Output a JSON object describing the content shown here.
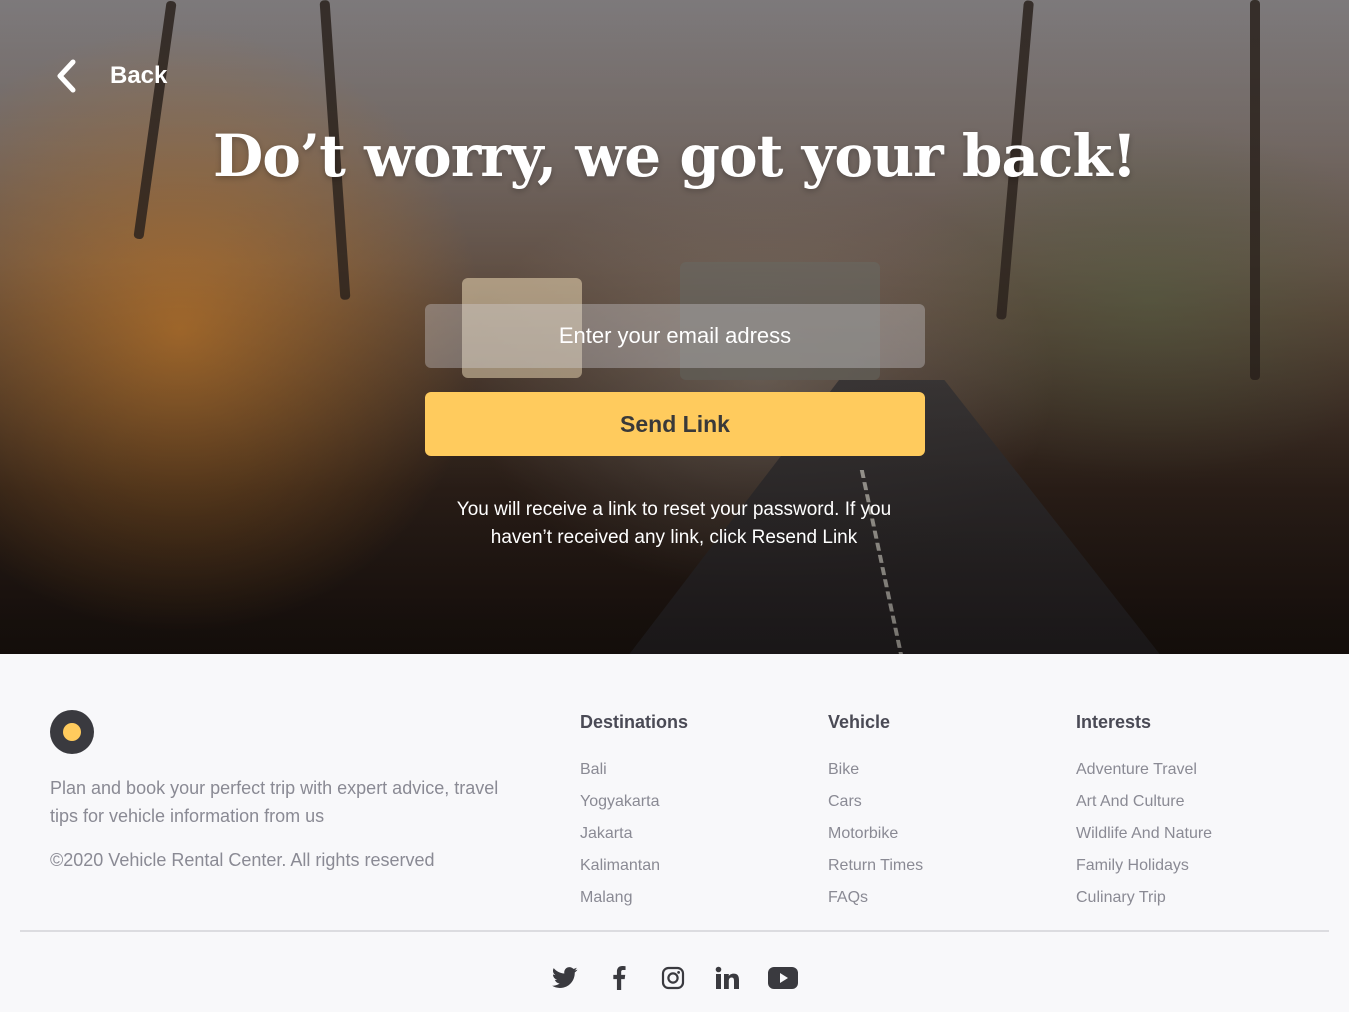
{
  "hero": {
    "back_label": "Back",
    "headline": "Do’t worry, we got your back!",
    "email_placeholder": "Enter your email adress",
    "send_label": "Send Link",
    "notice": "You will receive a link to reset your password. If you haven’t received any link, click Resend Link"
  },
  "colors": {
    "accent": "#ffcb5d",
    "footer_bg": "#f8f8fa",
    "text_muted": "#8a8a94",
    "heading_dark": "#4a4a55"
  },
  "footer": {
    "tagline": "Plan and book your perfect trip with expert advice, travel tips for vehicle information from us",
    "copyright": "©2020 Vehicle Rental Center. All rights reserved",
    "columns": [
      {
        "title": "Destinations",
        "links": [
          "Bali",
          "Yogyakarta",
          "Jakarta",
          "Kalimantan",
          "Malang"
        ]
      },
      {
        "title": "Vehicle",
        "links": [
          "Bike",
          "Cars",
          "Motorbike",
          "Return Times",
          "FAQs"
        ]
      },
      {
        "title": "Interests",
        "links": [
          "Adventure Travel",
          "Art And Culture",
          "Wildlife And Nature",
          "Family Holidays",
          "Culinary Trip"
        ]
      }
    ],
    "socials": [
      "twitter-icon",
      "facebook-icon",
      "instagram-icon",
      "linkedin-icon",
      "youtube-icon"
    ]
  }
}
